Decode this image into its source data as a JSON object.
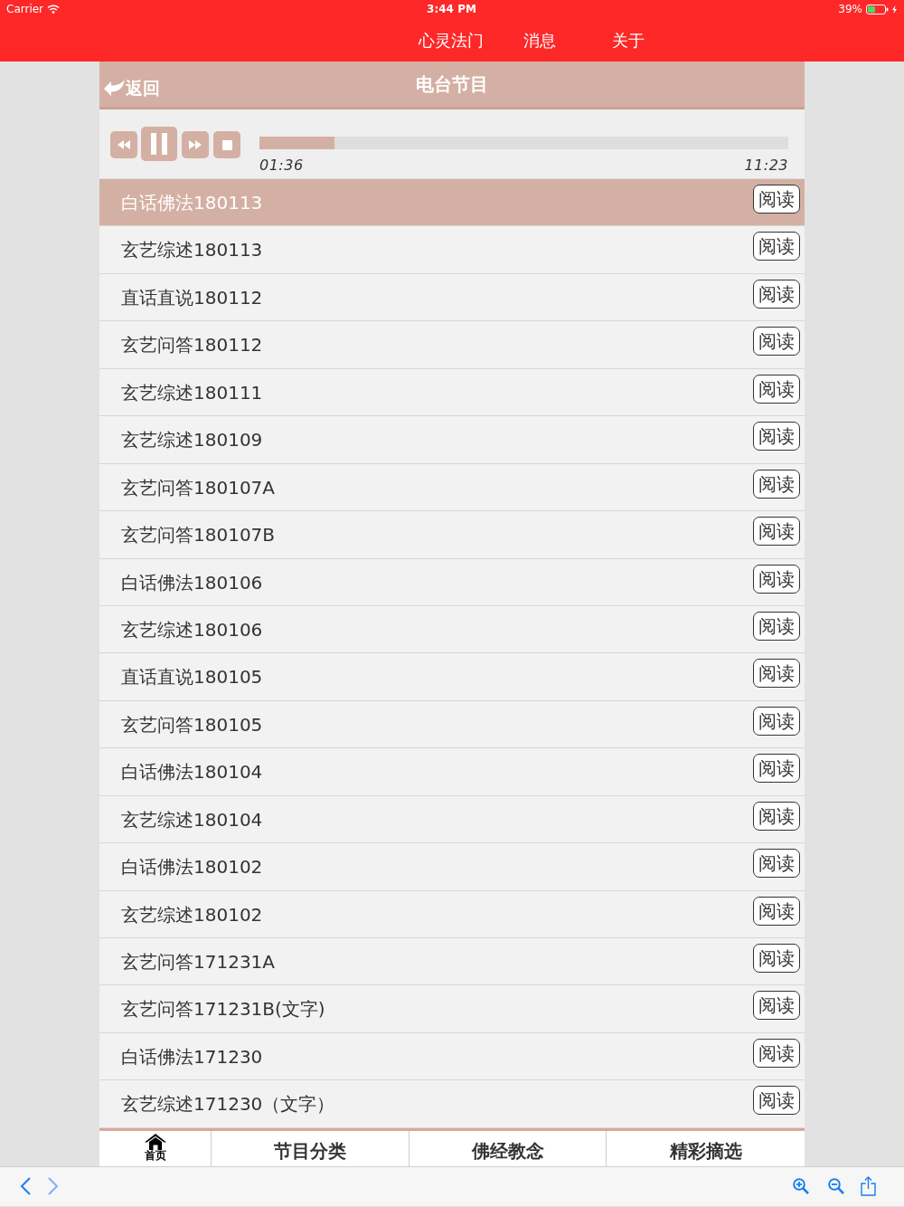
{
  "status_bar": {
    "carrier": "Carrier",
    "time": "3:44 PM",
    "battery": "39%"
  },
  "nav": {
    "tabs": [
      {
        "label": "心灵法门"
      },
      {
        "label": "消息"
      },
      {
        "label": "关于"
      }
    ]
  },
  "header": {
    "back": "返回",
    "title": "电台节目"
  },
  "player": {
    "playing": true,
    "level": 0.142,
    "elapsed": "01:36",
    "duration": "11:23"
  },
  "programs": [
    {
      "title": "白话佛法180113",
      "selected": true,
      "action": "阅读"
    },
    {
      "title": "玄艺综述180113",
      "selected": false,
      "action": "阅读"
    },
    {
      "title": "直话直说180112",
      "selected": false,
      "action": "阅读"
    },
    {
      "title": "玄艺问答180112",
      "selected": false,
      "action": "阅读"
    },
    {
      "title": "玄艺综述180111",
      "selected": false,
      "action": "阅读"
    },
    {
      "title": "玄艺综述180109",
      "selected": false,
      "action": "阅读"
    },
    {
      "title": "玄艺问答180107A",
      "selected": false,
      "action": "阅读"
    },
    {
      "title": "玄艺问答180107B",
      "selected": false,
      "action": "阅读"
    },
    {
      "title": "白话佛法180106",
      "selected": false,
      "action": "阅读"
    },
    {
      "title": "玄艺综述180106",
      "selected": false,
      "action": "阅读"
    },
    {
      "title": "直话直说180105",
      "selected": false,
      "action": "阅读"
    },
    {
      "title": "玄艺问答180105",
      "selected": false,
      "action": "阅读"
    },
    {
      "title": "白话佛法180104",
      "selected": false,
      "action": "阅读"
    },
    {
      "title": "玄艺综述180104",
      "selected": false,
      "action": "阅读"
    },
    {
      "title": "白话佛法180102",
      "selected": false,
      "action": "阅读"
    },
    {
      "title": "玄艺综述180102",
      "selected": false,
      "action": "阅读"
    },
    {
      "title": "玄艺问答171231A",
      "selected": false,
      "action": "阅读"
    },
    {
      "title": "玄艺问答171231B(文字)",
      "selected": false,
      "action": "阅读"
    },
    {
      "title": "白话佛法171230",
      "selected": false,
      "action": "阅读"
    },
    {
      "title": "玄艺综述171230（文字）",
      "selected": false,
      "action": "阅读"
    }
  ],
  "bottom_tabs": [
    {
      "kind": "home",
      "label": "首页"
    },
    {
      "kind": "text",
      "label": "节目分类"
    },
    {
      "kind": "text",
      "label": "佛经教念"
    },
    {
      "kind": "text",
      "label": "精彩摘选"
    }
  ]
}
